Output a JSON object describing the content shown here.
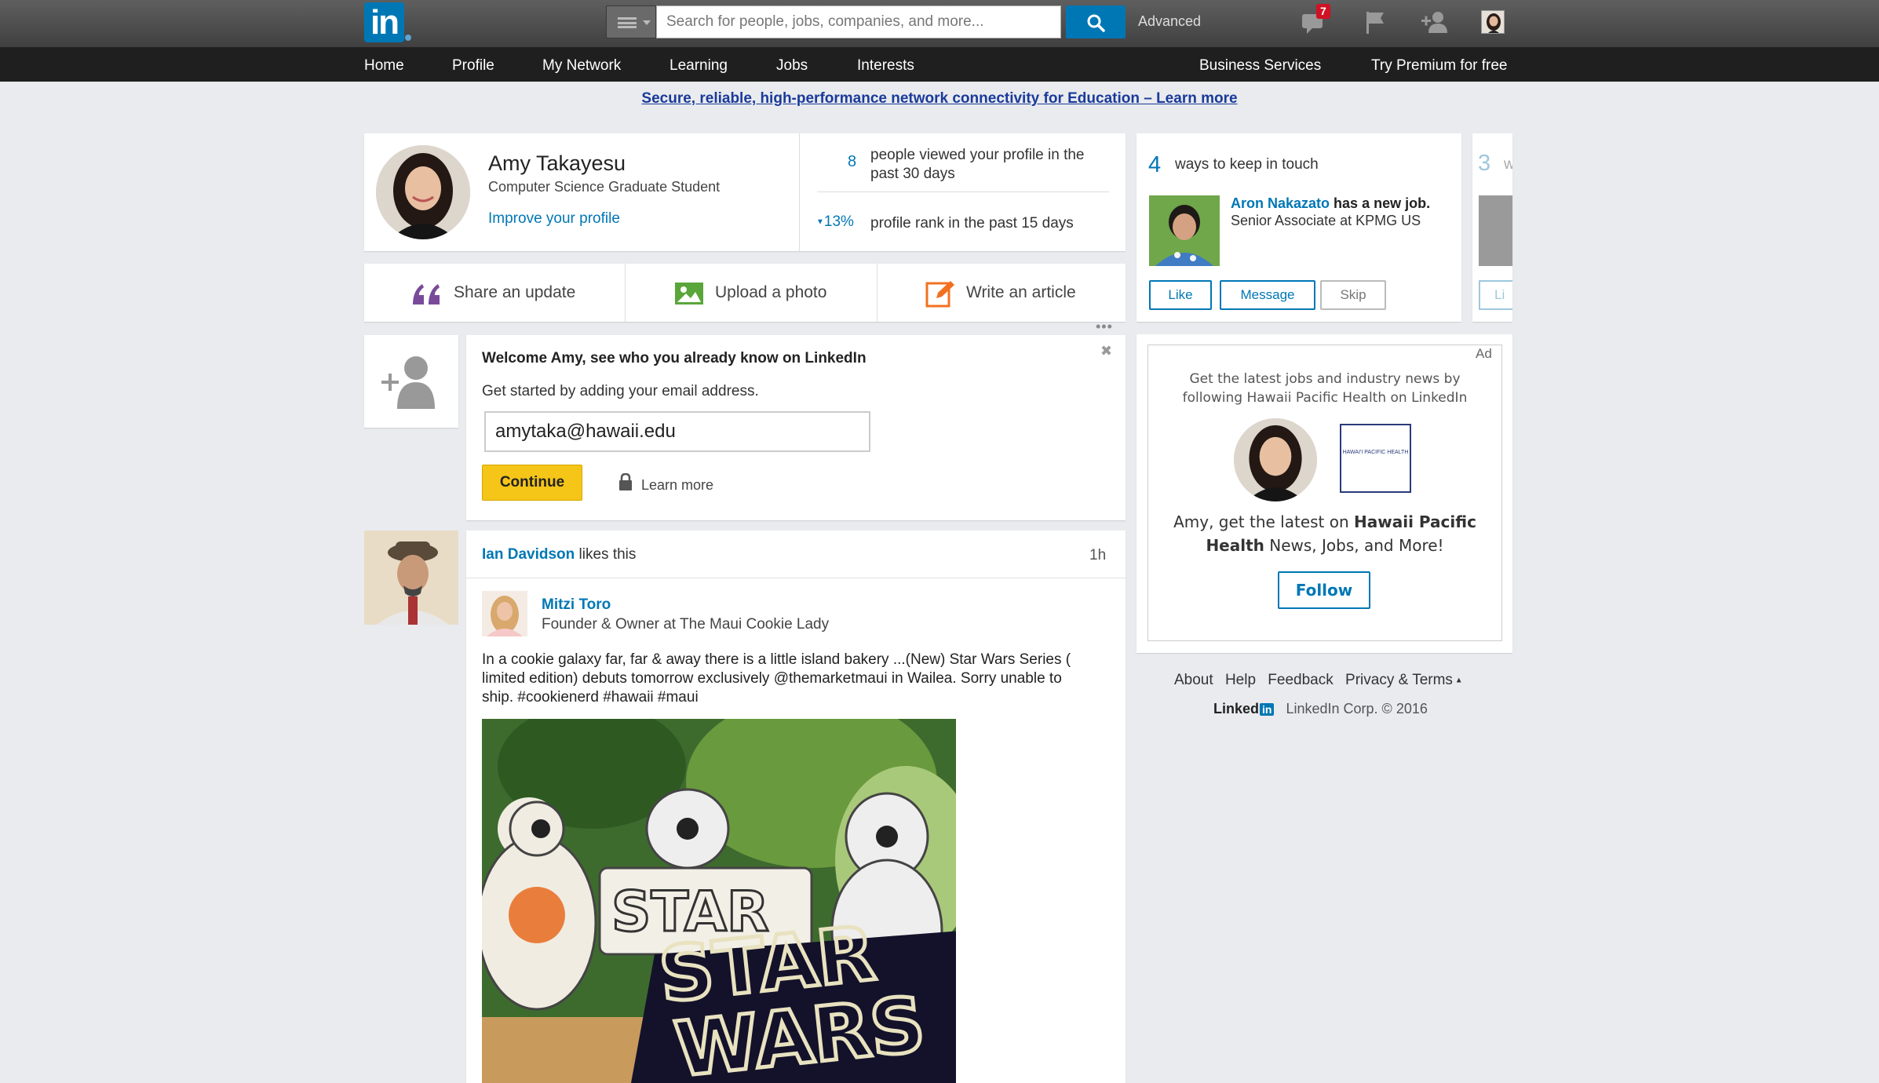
{
  "topbar": {
    "logo_text": "in",
    "search_placeholder": "Search for people, jobs, companies, and more...",
    "advanced_label": "Advanced",
    "messages_badge": "7",
    "icons": [
      "messages-icon",
      "flag-icon",
      "add-connection-icon",
      "account-avatar"
    ]
  },
  "nav": {
    "items": [
      "Home",
      "Profile",
      "My Network",
      "Learning",
      "Jobs",
      "Interests"
    ],
    "business": "Business Services",
    "premium": "Try Premium for free"
  },
  "banner": {
    "text": "Secure, reliable, high-performance network connectivity for Education – Learn more"
  },
  "profile": {
    "name": "Amy Takayesu",
    "headline": "Computer Science Graduate Student",
    "improve_link": "Improve your profile",
    "views_count": "8",
    "views_text": "people viewed your profile in the past 30 days",
    "rank_change": "13%",
    "rank_text": "profile rank in the past 15 days"
  },
  "share": {
    "update": "Share an update",
    "photo": "Upload a photo",
    "article": "Write an article"
  },
  "welcome": {
    "title": "Welcome Amy, see who you already know on LinkedIn",
    "subtitle": "Get started by adding your email address.",
    "email_value": "amytaka@hawaii.edu",
    "continue": "Continue",
    "learn_more": "Learn more"
  },
  "feed": {
    "liker": "Ian Davidson",
    "likes_this": "likes this",
    "time": "1h",
    "author": "Mitzi Toro",
    "author_headline": "Founder & Owner at The Maui Cookie Lady",
    "post_text": "In a cookie galaxy far, far & away there is a little island bakery ...(New) Star Wars Series ( limited edition) debuts tomorrow exclusively @themarketmaui in Wailea. Sorry unable to ship. #cookienerd #hawaii #maui",
    "image_text_1": "STAR",
    "image_text_2": "STAR",
    "image_text_3": "WARS"
  },
  "keep_in_touch": {
    "count": "4",
    "label": "ways to keep in touch",
    "person": "Aron Nakazato",
    "event": "has a new job.",
    "job": "Senior Associate at KPMG US",
    "like": "Like",
    "message": "Message",
    "skip": "Skip",
    "next_count": "3",
    "next_label_fragment": "w",
    "next_like_fragment": "Li"
  },
  "ad": {
    "ad_label": "Ad",
    "intro": "Get the latest jobs and industry news by following Hawaii Pacific Health on LinkedIn",
    "company_logo_text": "HAWAI'I PACIFIC HEALTH",
    "pitch_prefix": "Amy, get the latest on ",
    "pitch_company": "Hawaii Pacific Health",
    "pitch_suffix": " News, Jobs, and More!",
    "follow": "Follow"
  },
  "footer": {
    "links": [
      "About",
      "Help",
      "Feedback",
      "Privacy & Terms"
    ],
    "brand": "Linked",
    "brand_in": "in",
    "copyright": "LinkedIn Corp. © 2016"
  },
  "colors": {
    "brand": "#0077b5",
    "premium_yellow": "#f5c518",
    "topbar": "#4a4a4a",
    "navbar": "#1f1f1f",
    "background": "#e9ebee"
  }
}
